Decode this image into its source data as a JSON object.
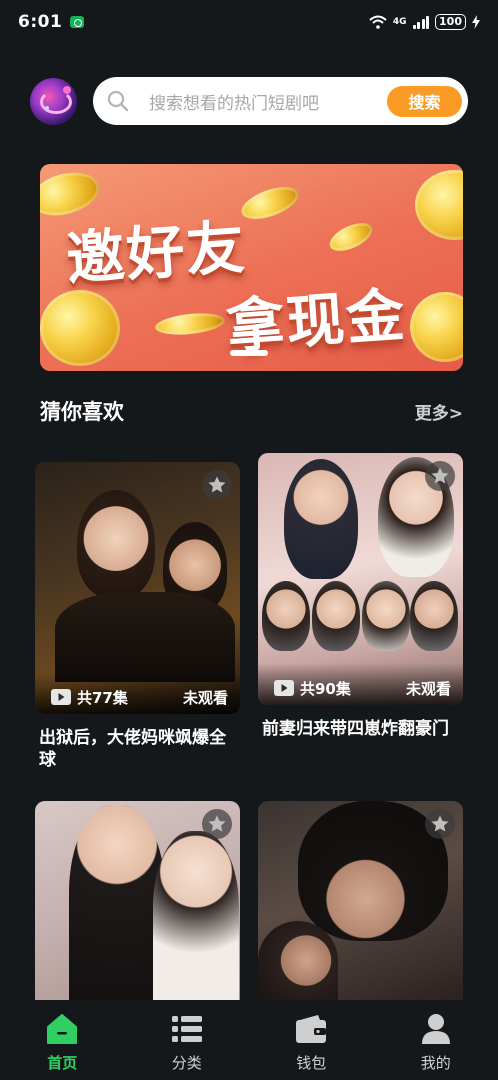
{
  "status_bar": {
    "time": "6:01",
    "network": "4G",
    "battery": "100"
  },
  "search": {
    "placeholder": "搜索想看的热门短剧吧",
    "button_label": "搜索"
  },
  "banner": {
    "line1": "邀好友",
    "line2": "拿现金"
  },
  "section": {
    "title": "猜你喜欢",
    "more_label": "更多>"
  },
  "cards": [
    {
      "title": "出狱后，大佬妈咪飒爆全球",
      "episodes": "共77集",
      "status": "未观看"
    },
    {
      "title": "前妻归来带四崽炸翻豪门",
      "episodes": "共90集",
      "status": "未观看"
    },
    {
      "title": "",
      "episodes": "",
      "status": ""
    },
    {
      "title": "",
      "episodes": "",
      "status": ""
    }
  ],
  "tabs": [
    {
      "label": "首页",
      "icon": "home-icon",
      "active": true
    },
    {
      "label": "分类",
      "icon": "category-list-icon",
      "active": false
    },
    {
      "label": "钱包",
      "icon": "wallet-icon",
      "active": false
    },
    {
      "label": "我的",
      "icon": "profile-icon",
      "active": false
    }
  ],
  "colors": {
    "background": "#15181b",
    "accent_green": "#2fcf63",
    "search_button": "#f99b25"
  }
}
